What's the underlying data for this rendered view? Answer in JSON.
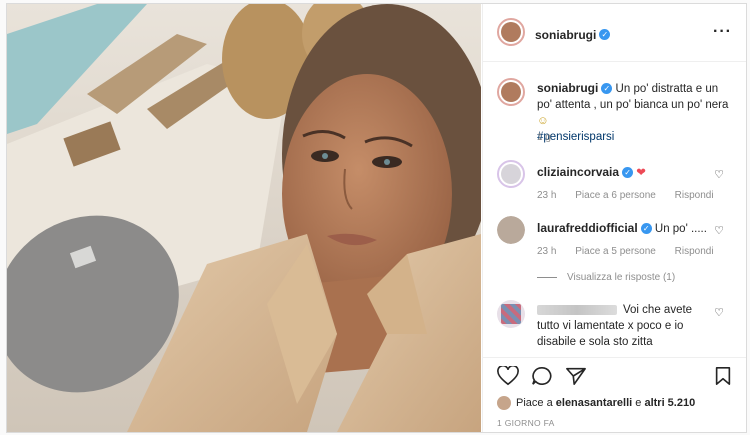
{
  "post": {
    "username": "soniabrugi",
    "more_icon": "more-dots-icon"
  },
  "caption": {
    "username": "soniabrugi",
    "text": "Un po' distratta e un po' attenta , un po' bianca un po' nera",
    "emoji": "☺",
    "hashtag": "#pensierisparsi",
    "age": "1 g"
  },
  "comments": [
    {
      "username": "cliziaincorvaia",
      "text": "❤",
      "age": "23 h",
      "likes": "Piace a 6 persone",
      "reply": "Rispondi"
    },
    {
      "username": "laurafreddiofficial",
      "text": "Un po' .....",
      "age": "23 h",
      "likes": "Piace a 5 persone",
      "reply": "Rispondi",
      "view_replies": "Visualizza le risposte (1)"
    },
    {
      "username": "",
      "text": "Voi che avete tutto vi lamentate x poco e io disabile e sola sto zitta"
    }
  ],
  "actions": {
    "like_icon": "heart-outline-icon",
    "comment_icon": "comment-bubble-icon",
    "share_icon": "paper-plane-icon",
    "save_icon": "bookmark-icon"
  },
  "likes": {
    "prefix": "Piace a",
    "user": "elenasantarelli",
    "middle": "e",
    "others": "altri 5.210"
  },
  "timestamp": "1 GIORNO FA",
  "colors": {
    "verified": "#3897f0",
    "heart_red": "#ed4956",
    "link_blue": "#00376b",
    "muted": "#8e8e8e"
  }
}
